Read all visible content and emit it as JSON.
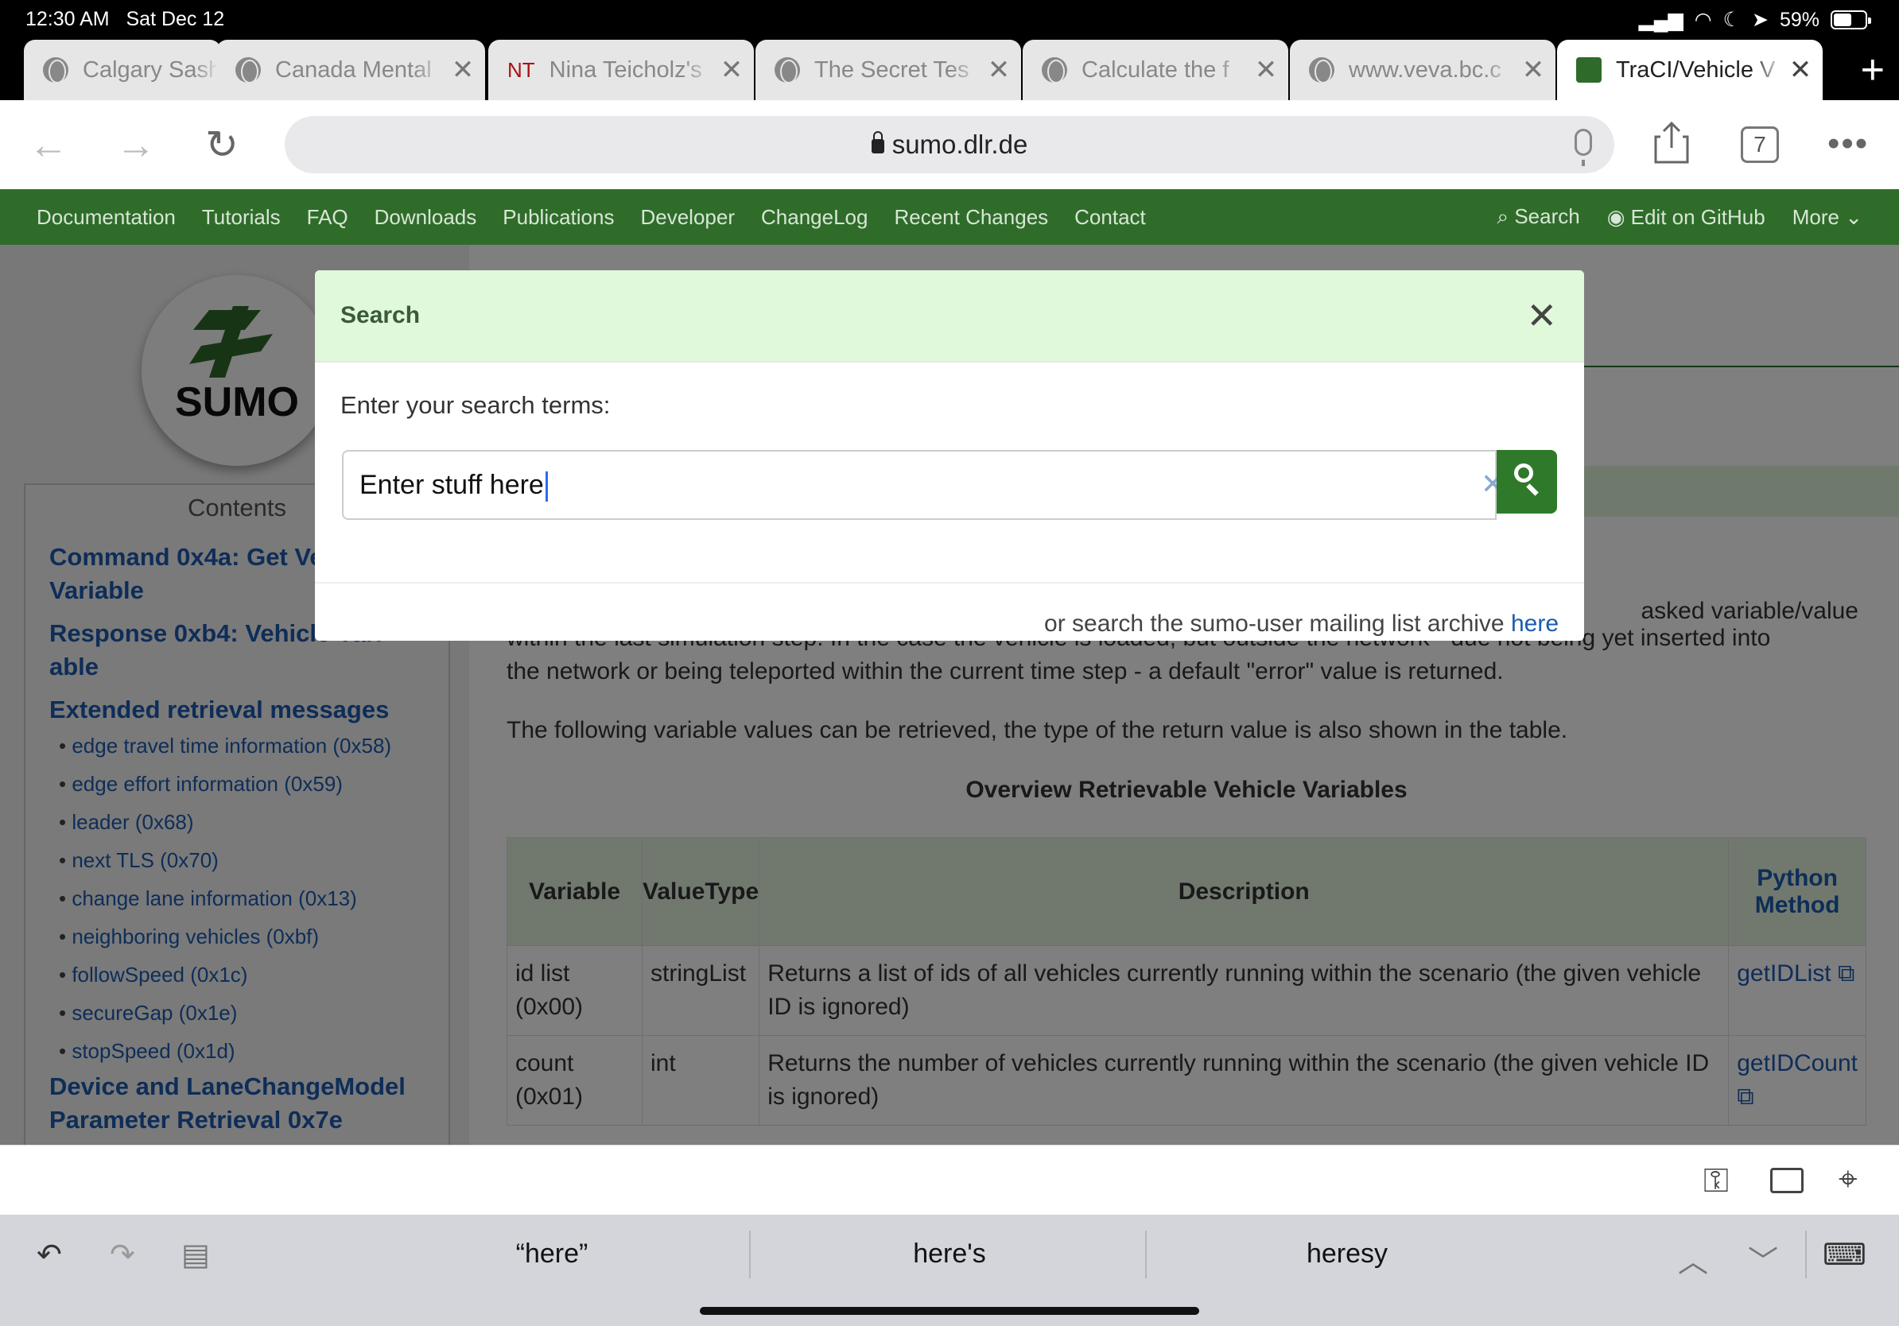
{
  "status_bar": {
    "time": "12:30 AM",
    "date": "Sat Dec 12",
    "battery": "59%"
  },
  "tabs": [
    {
      "title": "Calgary Sash",
      "icon": "globe-icon"
    },
    {
      "title": "Canada Mental",
      "icon": "globe-icon"
    },
    {
      "title": "Nina Teicholz's",
      "icon": "nt-icon",
      "icon_text": "NT"
    },
    {
      "title": "The Secret Tes",
      "icon": "globe-icon"
    },
    {
      "title": "Calculate the f",
      "icon": "globe-icon"
    },
    {
      "title": "www.veva.bc.c",
      "icon": "globe-icon"
    },
    {
      "title": "TraCI/Vehicle V",
      "icon": "sumo-icon",
      "active": true
    }
  ],
  "toolbar": {
    "url": "sumo.dlr.de",
    "tab_count": "7"
  },
  "site_nav": {
    "items": [
      "Documentation",
      "Tutorials",
      "FAQ",
      "Downloads",
      "Publications",
      "Developer",
      "ChangeLog",
      "Recent Changes",
      "Contact"
    ],
    "search": "Search",
    "edit": "Edit on GitHub",
    "more": "More"
  },
  "logo": {
    "text": "SUMO"
  },
  "sidebar": {
    "header": "Contents",
    "links": [
      {
        "text": "Command 0x4a: Get Ve",
        "level": 1
      },
      {
        "text": "Variable",
        "level": 1
      },
      {
        "text": "Response 0xb4: Vehicle Vari-",
        "level": 1
      },
      {
        "text": "able",
        "level": 1
      },
      {
        "text": "Extended retrieval messages",
        "level": 1
      },
      {
        "text": "edge travel time information (0x58)",
        "level": 2
      },
      {
        "text": "edge effort information (0x59)",
        "level": 2
      },
      {
        "text": "leader (0x68)",
        "level": 2
      },
      {
        "text": "next TLS (0x70)",
        "level": 2
      },
      {
        "text": "change lane information (0x13)",
        "level": 2
      },
      {
        "text": "neighboring vehicles (0xbf)",
        "level": 2
      },
      {
        "text": "followSpeed (0x1c)",
        "level": 2
      },
      {
        "text": "secureGap (0x1e)",
        "level": 2
      },
      {
        "text": "stopSpeed (0x1d)",
        "level": 2
      },
      {
        "text": "Device and LaneChangeModel",
        "level": 1
      },
      {
        "text": "Parameter Retrieval 0x7e",
        "level": 1
      }
    ]
  },
  "content": {
    "para1_tail": "asked variable/value",
    "para1_line2": "within the last simulation step. In the case the vehicle is loaded, but outside the network - due not being yet inserted into",
    "para1_line3": "the network or being teleported within the current time step - a default \"error\" value is returned.",
    "para2": "The following variable values can be retrieved, the type of the return value is also shown in the table.",
    "table_caption": "Overview Retrievable Vehicle Variables",
    "table_headers": [
      "Variable",
      "ValueType",
      "Description",
      "Python Method"
    ],
    "rows": [
      {
        "variable": "id list (0x00)",
        "type": "stringList",
        "description": "Returns a list of ids of all vehicles currently running within the scenario (the given vehicle ID is ignored)",
        "method": "getIDList"
      },
      {
        "variable": "count (0x01)",
        "type": "int",
        "description": "Returns the number of vehicles currently running within the scenario (the given vehicle ID is ignored)",
        "method": "getIDCount"
      }
    ]
  },
  "modal": {
    "title": "Search",
    "label": "Enter your search terms:",
    "input_value": "Enter stuff here",
    "footer_text": "or search the sumo-user mailing list archive",
    "footer_link": "here"
  },
  "keyboard": {
    "suggestions": [
      "“here”",
      "here's",
      "heresy"
    ]
  },
  "colors": {
    "nav_green": "#2f6c2a",
    "modal_header": "#dff9da",
    "link_blue": "#1c5bb0",
    "search_button": "#2f7a2a"
  }
}
